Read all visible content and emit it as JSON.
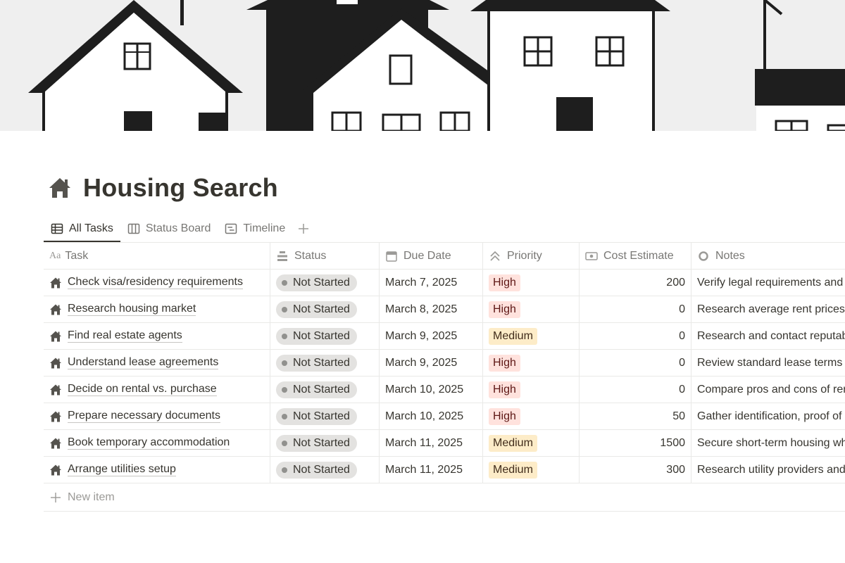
{
  "page": {
    "title": "Housing Search",
    "icon": "house-icon"
  },
  "tabs": [
    {
      "label": "All Tasks",
      "icon": "table-icon",
      "active": true
    },
    {
      "label": "Status Board",
      "icon": "board-icon",
      "active": false
    },
    {
      "label": "Timeline",
      "icon": "timeline-icon",
      "active": false
    }
  ],
  "columns": {
    "task": "Task",
    "status": "Status",
    "due": "Due Date",
    "priority": "Priority",
    "cost": "Cost Estimate",
    "notes": "Notes"
  },
  "priority_colors": {
    "High": {
      "bg": "#ffe2dd",
      "fg": "#5d1715"
    },
    "Medium": {
      "bg": "#fdecc8",
      "fg": "#402c1b"
    }
  },
  "rows": [
    {
      "task": "Check visa/residency requirements",
      "status": "Not Started",
      "due": "March 7, 2025",
      "priority": "High",
      "cost": "200",
      "notes": "Verify legal requirements and"
    },
    {
      "task": "Research housing market",
      "status": "Not Started",
      "due": "March 8, 2025",
      "priority": "High",
      "cost": "0",
      "notes": "Research average rent prices,"
    },
    {
      "task": "Find real estate agents",
      "status": "Not Started",
      "due": "March 9, 2025",
      "priority": "Medium",
      "cost": "0",
      "notes": "Research and contact reputab"
    },
    {
      "task": "Understand lease agreements",
      "status": "Not Started",
      "due": "March 9, 2025",
      "priority": "High",
      "cost": "0",
      "notes": "Review standard lease terms a"
    },
    {
      "task": "Decide on rental vs. purchase",
      "status": "Not Started",
      "due": "March 10, 2025",
      "priority": "High",
      "cost": "0",
      "notes": "Compare pros and cons of ren"
    },
    {
      "task": "Prepare necessary documents",
      "status": "Not Started",
      "due": "March 10, 2025",
      "priority": "High",
      "cost": "50",
      "notes": "Gather identification, proof of"
    },
    {
      "task": "Book temporary accommodation",
      "status": "Not Started",
      "due": "March 11, 2025",
      "priority": "Medium",
      "cost": "1500",
      "notes": "Secure short-term housing wh"
    },
    {
      "task": "Arrange utilities setup",
      "status": "Not Started",
      "due": "March 11, 2025",
      "priority": "Medium",
      "cost": "300",
      "notes": "Research utility providers and"
    }
  ],
  "new_item_label": "New item"
}
